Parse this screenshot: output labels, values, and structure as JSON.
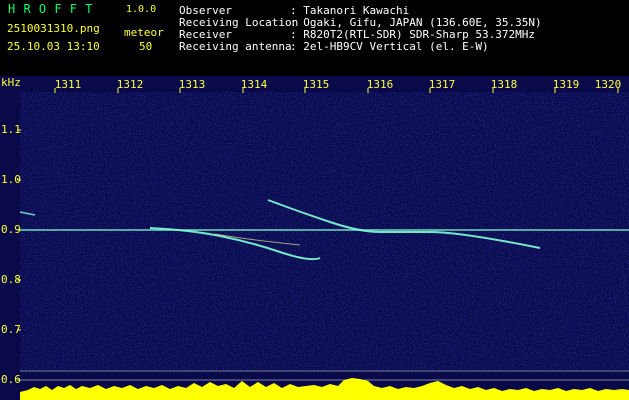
{
  "header": {
    "app_name": "H R O F F T",
    "version": "1.0.0",
    "filename": "2510031310.png",
    "datetime": "25.10.03 13:10",
    "meteor_label": "meteor",
    "meteor_count": "50",
    "info": [
      {
        "label": "Observer",
        "value": ": Takanori Kawachi"
      },
      {
        "label": "Receiving Location",
        "value": ": Ogaki, Gifu, JAPAN (136.60E, 35.35N)"
      },
      {
        "label": "Receiver",
        "value": ": R820T2(RTL-SDR) SDR-Sharp 53.372MHz"
      },
      {
        "label": "Receiving antenna",
        "value": ": 2el-HB9CV Vertical (el. E-W)"
      }
    ]
  },
  "spectrogram": {
    "unit_label": "kHz",
    "x_ticks": [
      "1311",
      "1312",
      "1313",
      "1314",
      "1315",
      "1316",
      "1317",
      "1318",
      "1319",
      "1320"
    ],
    "y_ticks": [
      "1.1",
      "1.0",
      "0.9",
      "0.8",
      "0.7",
      "0.6"
    ],
    "colors": {
      "background": "#0a0a4a",
      "signal": "#7fffd4",
      "level_bar": "#ffff00",
      "level_base": "#00c8ff"
    }
  }
}
